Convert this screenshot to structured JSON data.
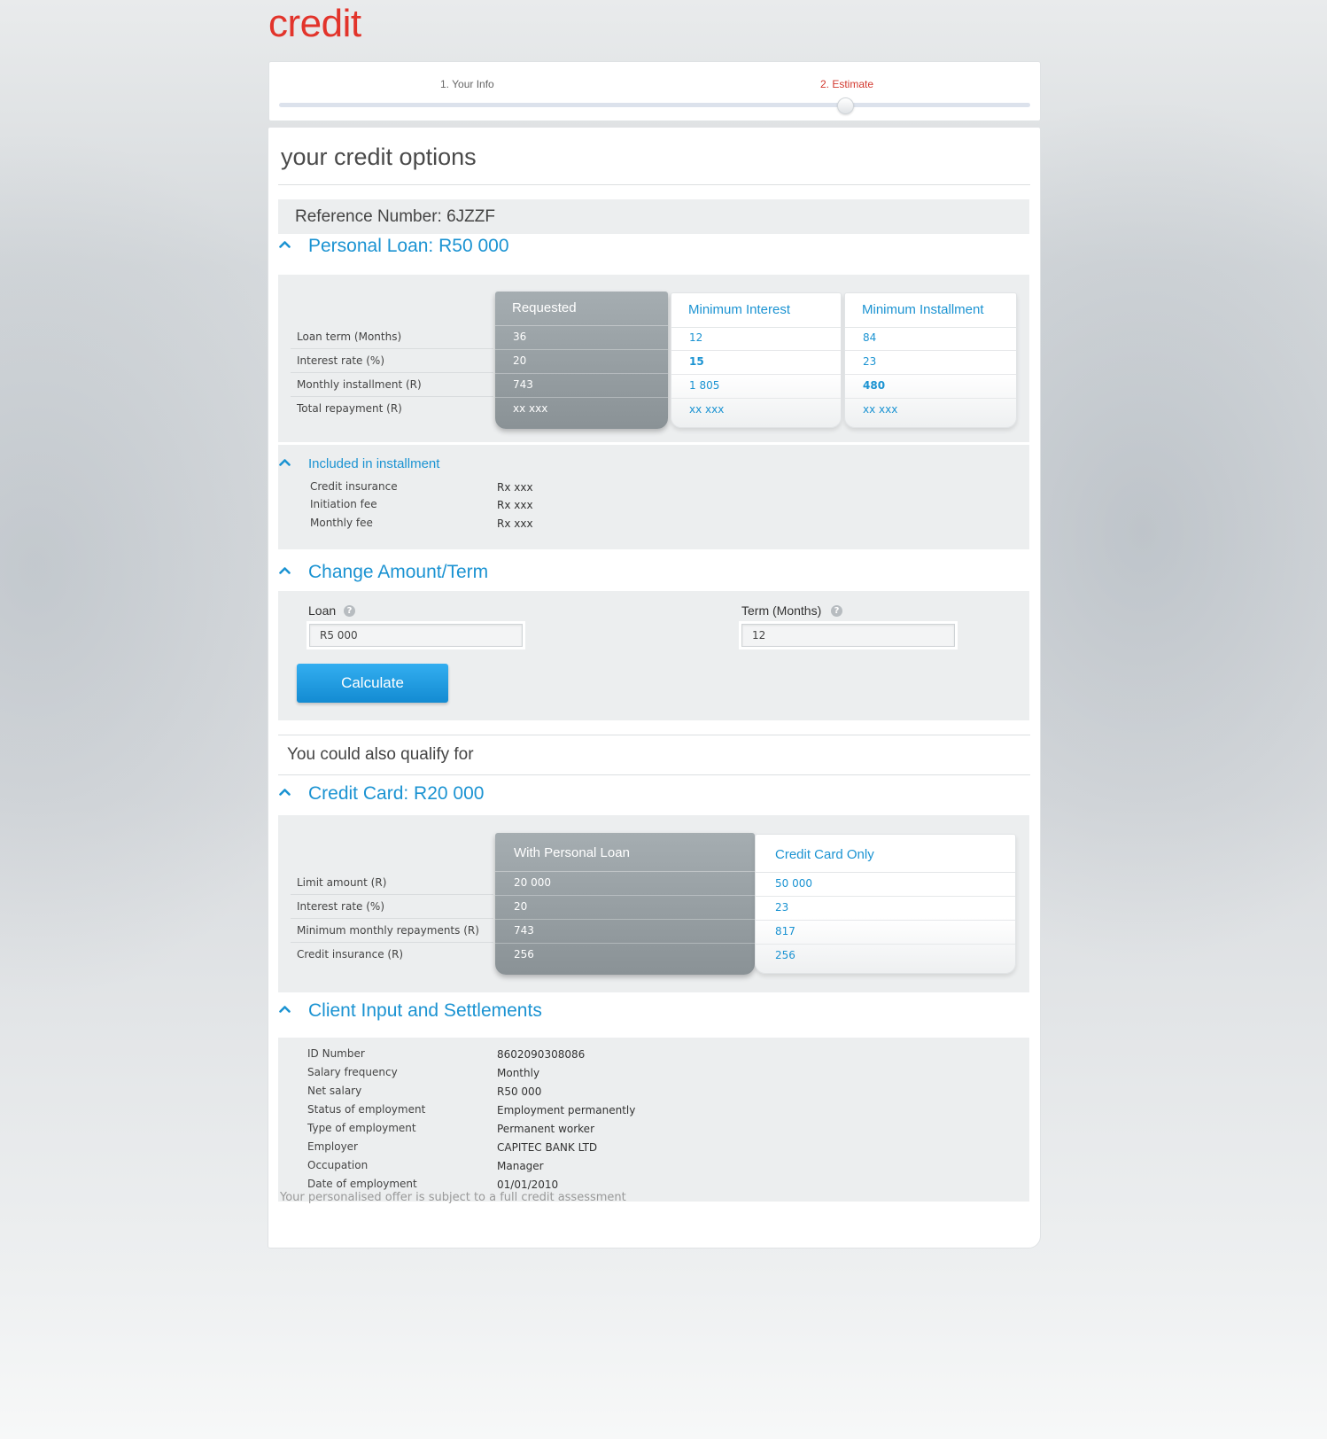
{
  "brand": "credit",
  "steps": [
    {
      "label": "1. Your Info",
      "active": false
    },
    {
      "label": "2. Estimate",
      "active": true
    }
  ],
  "page_title": "your credit options",
  "reference": "Reference Number: 6JZZF",
  "personal_loan": {
    "title": "Personal Loan: R50 000",
    "row_labels": [
      "Loan term (Months)",
      "Interest rate (%)",
      "Monthly installment (R)",
      "Total repayment (R)"
    ],
    "columns": [
      {
        "header": "Requested",
        "values": [
          "36",
          "20",
          "743",
          "xx xxx"
        ]
      },
      {
        "header": "Minimum Interest",
        "values": [
          "12",
          "15",
          "1 805",
          "xx xxx"
        ]
      },
      {
        "header": "Minimum Installment",
        "values": [
          "84",
          "23",
          "480",
          "xx xxx"
        ]
      }
    ]
  },
  "included": {
    "title": "Included in installment",
    "items": [
      {
        "label": "Credit insurance",
        "value": "Rx xxx"
      },
      {
        "label": "Initiation fee",
        "value": "Rx xxx"
      },
      {
        "label": "Monthly fee",
        "value": "Rx xxx"
      }
    ]
  },
  "change": {
    "title": "Change Amount/Term",
    "loan_label": "Loan",
    "loan_value": "R5 000",
    "term_label": "Term (Months)",
    "term_value": "12",
    "help_glyph": "?",
    "button": "Calculate"
  },
  "qualify_heading": "You could also qualify for",
  "credit_card": {
    "title": "Credit Card: R20 000",
    "row_labels": [
      "Limit amount (R)",
      "Interest rate (%)",
      "Minimum monthly repayments (R)",
      "Credit insurance (R)"
    ],
    "columns": [
      {
        "header": "With Personal Loan",
        "values": [
          "20 000",
          "20",
          "743",
          "256"
        ]
      },
      {
        "header": "Credit Card Only",
        "values": [
          "50 000",
          "23",
          "817",
          "256"
        ]
      }
    ]
  },
  "client": {
    "title": "Client Input and Settlements",
    "items": [
      {
        "label": "ID Number",
        "value": "8602090308086"
      },
      {
        "label": "Salary frequency",
        "value": "Monthly"
      },
      {
        "label": "Net salary",
        "value": "R50 000"
      },
      {
        "label": "Status of employment",
        "value": "Employment permanently"
      },
      {
        "label": "Type of employment",
        "value": "Permanent worker"
      },
      {
        "label": "Employer",
        "value": "CAPITEC BANK LTD"
      },
      {
        "label": "Occupation",
        "value": "Manager"
      },
      {
        "label": "Date of employment",
        "value": "01/01/2010"
      }
    ]
  },
  "disclaimer": "Your personalised offer is subject to a full credit assessment",
  "colors": {
    "brand": "#e2342b",
    "accent": "#1b93d2",
    "active_step": "#d2382e"
  }
}
